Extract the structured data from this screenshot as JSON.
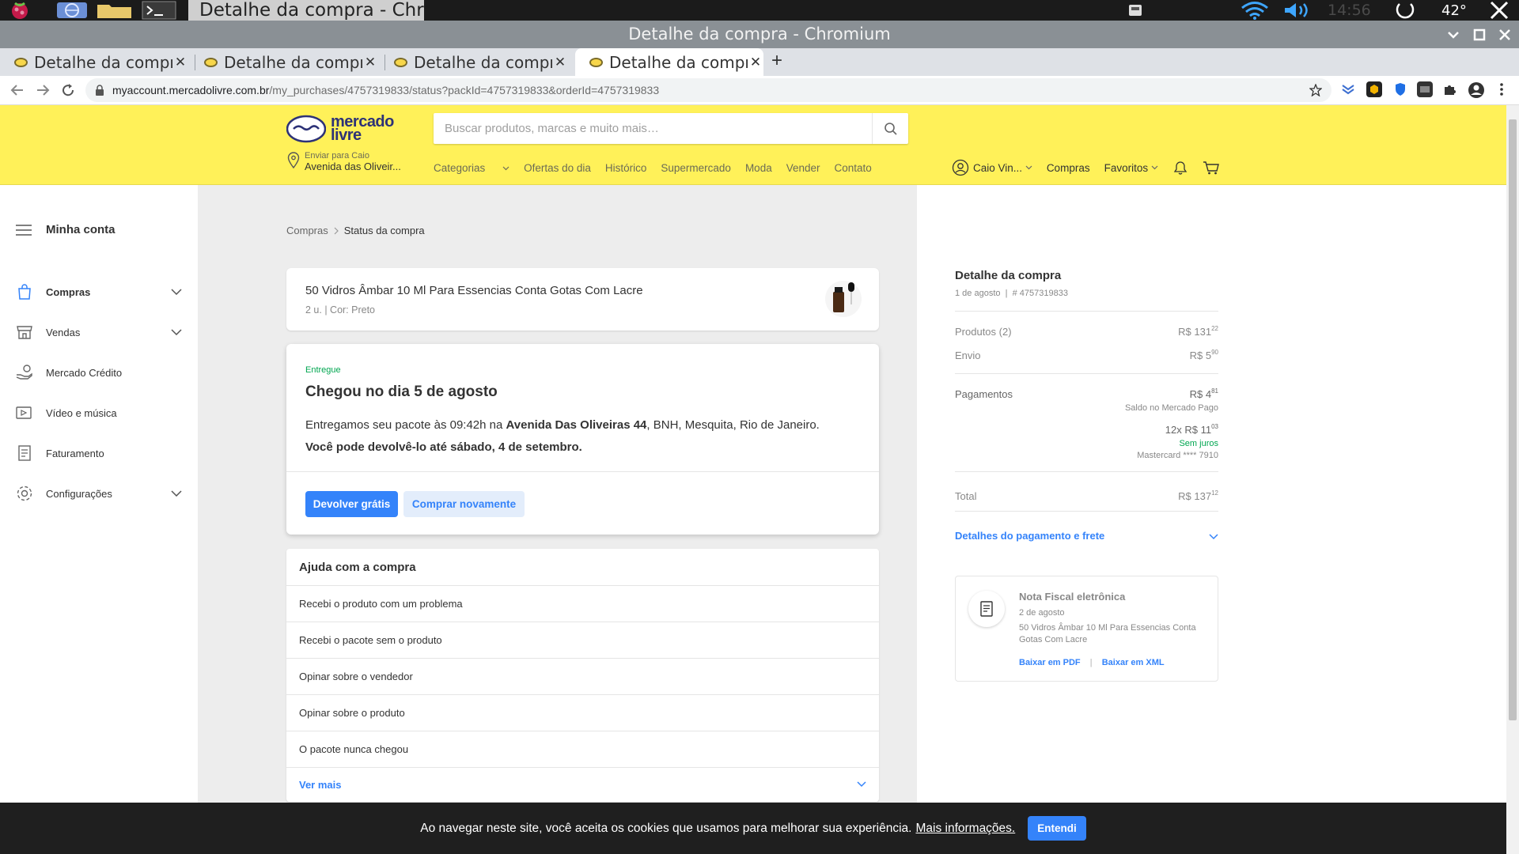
{
  "os": {
    "window_button": "Detalhe da compra - Chr...",
    "clock": "14:56",
    "temperature": "42°"
  },
  "window": {
    "title": "Detalhe da compra - Chromium"
  },
  "browser": {
    "tabs": [
      {
        "label": "Detalhe da compra",
        "active": false
      },
      {
        "label": "Detalhe da compra",
        "active": false
      },
      {
        "label": "Detalhe da compra",
        "active": false
      },
      {
        "label": "Detalhe da compra",
        "active": true
      }
    ],
    "url_host": "myaccount.mercadolivre.com.br",
    "url_path": "/my_purchases/4757319833/status?packId=4757319833&orderId=4757319833"
  },
  "header": {
    "logo_line1": "mercado",
    "logo_line2": "livre",
    "search_placeholder": "Buscar produtos, marcas e muito mais…",
    "location_label": "Enviar para Caio",
    "location_address": "Avenida das Oliveir...",
    "nav": [
      "Categorias",
      "Ofertas do dia",
      "Histórico",
      "Supermercado",
      "Moda",
      "Vender",
      "Contato"
    ],
    "user": "Caio Vin...",
    "purchases": "Compras",
    "favorites": "Favoritos"
  },
  "sidebar": {
    "title": "Minha conta",
    "items": [
      {
        "label": "Compras",
        "icon": "bag-icon",
        "expandable": true,
        "active": true
      },
      {
        "label": "Vendas",
        "icon": "store-icon",
        "expandable": true
      },
      {
        "label": "Mercado Crédito",
        "icon": "hand-coin-icon",
        "expandable": false
      },
      {
        "label": "Vídeo e música",
        "icon": "media-icon",
        "expandable": false
      },
      {
        "label": "Faturamento",
        "icon": "invoice-icon",
        "expandable": false
      },
      {
        "label": "Configurações",
        "icon": "gear-icon",
        "expandable": true
      }
    ]
  },
  "breadcrumb": {
    "parent": "Compras",
    "current": "Status da compra"
  },
  "product": {
    "title": "50 Vidros Âmbar 10 Ml Para Essencias Conta Gotas Com Lacre",
    "meta": "2 u. | Cor: Preto"
  },
  "status": {
    "badge": "Entregue",
    "title": "Chegou no dia 5 de agosto",
    "line1_prefix": "Entregamos seu pacote às 09:42h na ",
    "line1_address": "Avenida Das Oliveiras 44",
    "line1_suffix": ", BNH, Mesquita, Rio de Janeiro.",
    "line2": "Você pode devolvê-lo até sábado, 4 de setembro.",
    "return_button": "Devolver grátis",
    "buy_again_button": "Comprar novamente"
  },
  "help": {
    "title": "Ajuda com a compra",
    "items": [
      "Recebi o produto com um problema",
      "Recebi o pacote sem o produto",
      "Opinar sobre o vendedor",
      "Opinar sobre o produto",
      "O pacote nunca chegou"
    ],
    "more": "Ver mais"
  },
  "summary": {
    "title": "Detalhe da compra",
    "date": "1 de agosto",
    "order": "# 4757319833",
    "products_label": "Produtos (2)",
    "products_value": "R$ 131",
    "products_cents": "22",
    "shipping_label": "Envio",
    "shipping_value": "R$ 5",
    "shipping_cents": "90",
    "payments_label": "Pagamentos",
    "payment1_value": "R$ 4",
    "payment1_cents": "81",
    "payment1_method": "Saldo no Mercado Pago",
    "payment2_value": "12x R$ 11",
    "payment2_cents": "03",
    "payment2_interest": "Sem juros",
    "payment2_card": "Mastercard **** 7910",
    "total_label": "Total",
    "total_value": "R$ 137",
    "total_cents": "12",
    "details_link": "Detalhes do pagamento e frete"
  },
  "invoice": {
    "title": "Nota Fiscal eletrônica",
    "date": "2 de agosto",
    "description": "50 Vidros Âmbar 10 Ml Para Essencias Conta Gotas Com Lacre",
    "pdf_link": "Baixar em PDF",
    "xml_link": "Baixar em XML"
  },
  "cookie": {
    "text": "Ao navegar neste site, você aceita os cookies que usamos para melhorar sua experiência.",
    "link": "Mais informações.",
    "button": "Entendi"
  },
  "colors": {
    "brand_yellow": "#fff159",
    "accent_blue": "#3483fa",
    "success_green": "#00a650"
  }
}
